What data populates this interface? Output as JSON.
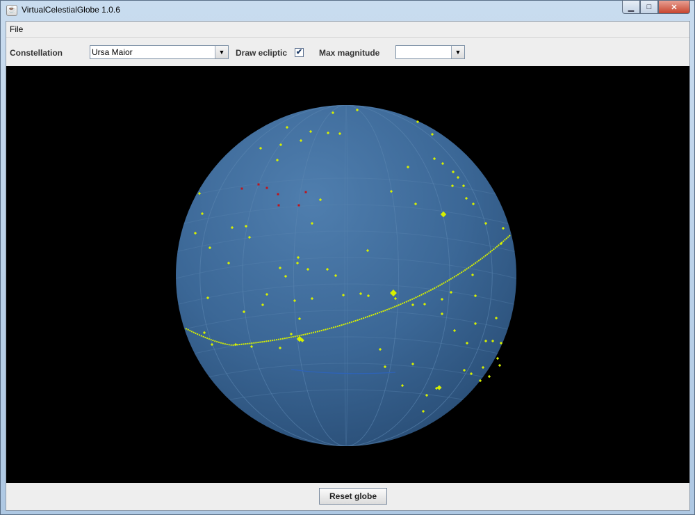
{
  "window": {
    "title": "VirtualCelestialGlobe 1.0.6",
    "minimize_glyph": "▁",
    "maximize_glyph": "□",
    "close_glyph": "✕"
  },
  "menubar": {
    "file_label": "File"
  },
  "toolbar": {
    "constellation_label": "Constellation",
    "constellation_value": "Ursa Maior",
    "draw_ecliptic_label": "Draw ecliptic",
    "draw_ecliptic_checked": true,
    "max_magnitude_label": "Max magnitude",
    "max_magnitude_value": ""
  },
  "globe": {
    "sphere_color": "#3b6796",
    "ecliptic_color": "#d6f000",
    "star_color": "#d6f000",
    "highlight_star_color": "#c0141c",
    "background_color": "#000000"
  },
  "bottom": {
    "reset_label": "Reset globe"
  }
}
